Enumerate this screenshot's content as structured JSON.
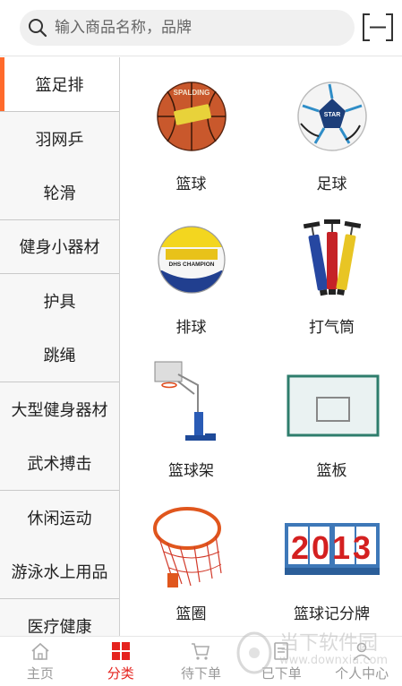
{
  "search": {
    "placeholder": "输入商品名称，品牌"
  },
  "sidebar": {
    "items": [
      {
        "label": "篮足排"
      },
      {
        "label": "羽网乒"
      },
      {
        "label": "轮滑"
      },
      {
        "label": "健身小器材"
      },
      {
        "label": "护具"
      },
      {
        "label": "跳绳"
      },
      {
        "label": "大型健身器材"
      },
      {
        "label": "武术搏击"
      },
      {
        "label": "休闲运动"
      },
      {
        "label": "游泳水上用品"
      },
      {
        "label": "医疗健康"
      }
    ]
  },
  "products": [
    {
      "name": "篮球",
      "image_text": "SPALDING"
    },
    {
      "name": "足球",
      "image_text": "STAR"
    },
    {
      "name": "排球",
      "image_text": "DHS CHAMPION"
    },
    {
      "name": "打气筒"
    },
    {
      "name": "篮球架"
    },
    {
      "name": "篮板"
    },
    {
      "name": "篮圈"
    },
    {
      "name": "篮球记分牌",
      "image_text": "2013"
    }
  ],
  "tabbar": {
    "tabs": [
      {
        "label": "主页"
      },
      {
        "label": "分类"
      },
      {
        "label": "待下单"
      },
      {
        "label": "已下单"
      },
      {
        "label": "个人中心"
      }
    ]
  },
  "watermark": {
    "text": "当下软件园",
    "url": "www.downxia.com"
  },
  "colors": {
    "accent": "#e5231e",
    "sidebar_indicator": "#ff6a2b"
  }
}
